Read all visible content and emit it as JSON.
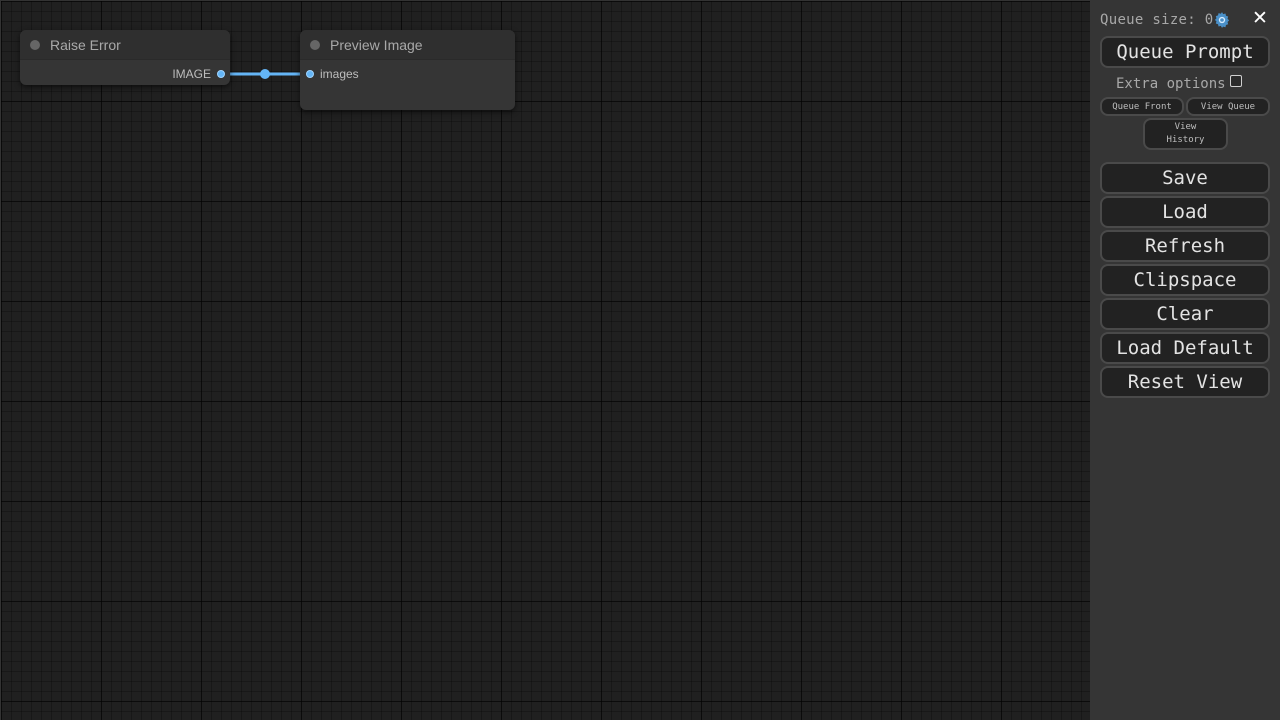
{
  "nodes": {
    "raise_error": {
      "title": "Raise Error",
      "output_label": "IMAGE"
    },
    "preview_image": {
      "title": "Preview Image",
      "input_label": "images"
    }
  },
  "link_color": "#64b5f6",
  "sidebar": {
    "queue_size_label": "Queue size: 0",
    "gear_icon": "gear-icon",
    "close_icon": "close-icon",
    "queue_prompt_label": "Queue Prompt",
    "extra_options_label": "Extra options",
    "extra_options_checked": false,
    "queue_front_label": "Queue Front",
    "view_queue_label": "View Queue",
    "view_history_label": "View History",
    "buttons": {
      "save": "Save",
      "load": "Load",
      "refresh": "Refresh",
      "clipspace": "Clipspace",
      "clear": "Clear",
      "load_default": "Load Default",
      "reset_view": "Reset View"
    }
  }
}
